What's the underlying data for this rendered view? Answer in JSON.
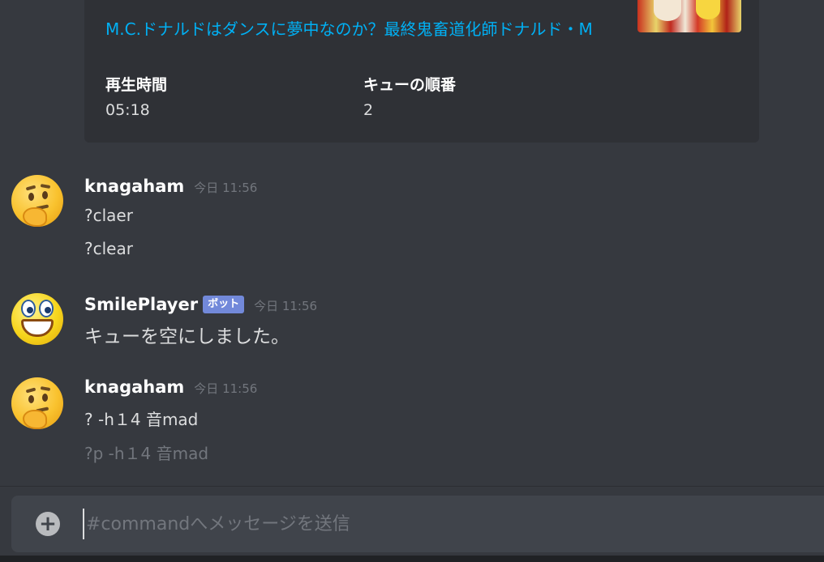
{
  "embed": {
    "title": "M.C.ドナルドはダンスに夢中なのか？最終鬼畜道化師ドナルド・M",
    "fields": [
      {
        "name": "再生時間",
        "value": "05:18"
      },
      {
        "name": "キューの順番",
        "value": "2"
      }
    ]
  },
  "messages": [
    {
      "username": "knagaham",
      "timestamp": "今日 11:56",
      "lines": [
        "?claer",
        "?clear"
      ]
    },
    {
      "username": "SmilePlayer",
      "bot_tag": "ボット",
      "timestamp": "今日 11:56",
      "lines": [
        "キューを空にしました。"
      ]
    },
    {
      "username": "knagaham",
      "timestamp": "今日 11:56",
      "lines": [
        "? -h１4 音mad",
        "?p -h１4 音mad"
      ]
    }
  ],
  "input": {
    "placeholder": "#commandへメッセージを送信",
    "value": ""
  },
  "colors": {
    "background": "#36393f",
    "embed_bg": "#2f3136",
    "link": "#00b0f4",
    "bot_tag": "#7289da",
    "input_bg": "#40444b"
  },
  "icons": {
    "attach": "plus-circle-icon"
  }
}
